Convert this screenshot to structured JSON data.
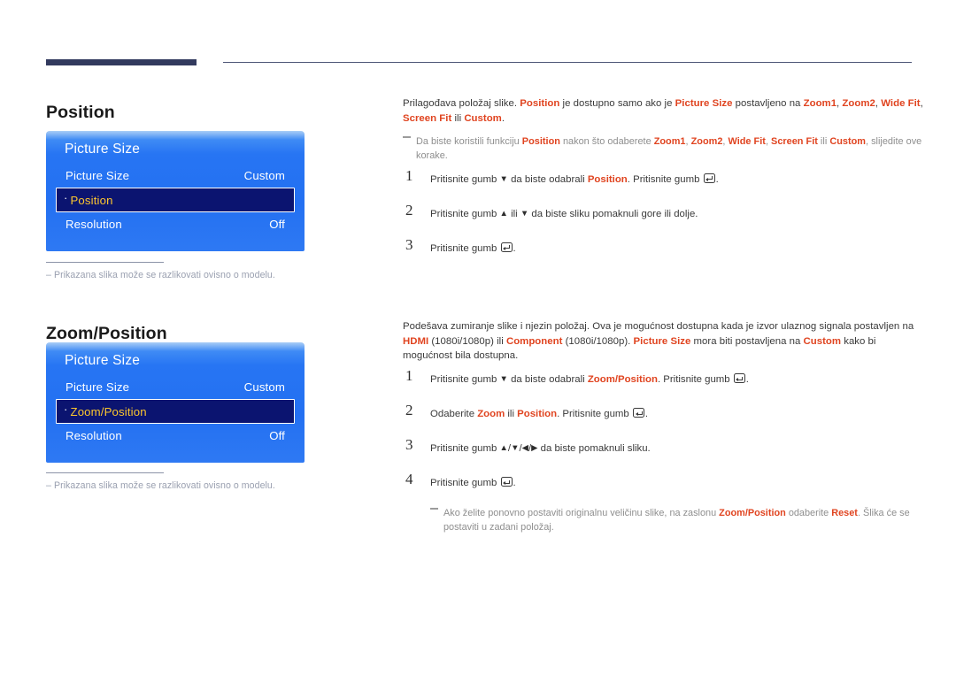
{
  "page": {
    "language": "hr",
    "accent_color": "#e04420",
    "panel_blue": "#2370f2",
    "panel_selected_bg": "#0b1470",
    "panel_selected_text": "#fdc72e",
    "rule_color": "#323a5e"
  },
  "sections": [
    {
      "id": "position",
      "title": "Position",
      "osd": {
        "header": "Picture Size",
        "rows": [
          {
            "label": "Picture Size",
            "value": "Custom",
            "selected": false,
            "bullet": ""
          },
          {
            "label": "Position",
            "value": "",
            "selected": true,
            "bullet": "·"
          },
          {
            "label": "Resolution",
            "value": "Off",
            "selected": false,
            "bullet": ""
          }
        ]
      },
      "panel_note": {
        "dash": "–",
        "text": "Prikazana slika može se razlikovati ovisno o modelu."
      },
      "intro": {
        "lead": "Prilagođava položaj slike. ",
        "hl1": "Position",
        "mid1": " je dostupno samo ako je ",
        "hl2": "Picture Size",
        "mid2": " postavljeno na ",
        "hl3": "Zoom1",
        "sep1": ", ",
        "hl4": "Zoom2",
        "sep2": ", ",
        "hl5": "Wide Fit",
        "sep3": ", ",
        "hl6": "Screen Fit",
        "mid3": " ili ",
        "hl7": "Custom",
        "tail": "."
      },
      "note": {
        "p1": "Da biste koristili funkciju ",
        "hl1": "Position",
        "p2": " nakon što odaberete ",
        "hl2": "Zoom1",
        "s1": ", ",
        "hl3": "Zoom2",
        "s2": ", ",
        "hl4": "Wide Fit",
        "s3": ", ",
        "hl5": "Screen Fit",
        "p3": " ili ",
        "hl6": "Custom",
        "p4": ", slijedite ove korake."
      },
      "steps": [
        {
          "num": "1",
          "parts": [
            {
              "t": "text",
              "v": "Pritisnite gumb "
            },
            {
              "t": "arrow",
              "v": "▼"
            },
            {
              "t": "text",
              "v": " da biste odabrali "
            },
            {
              "t": "hl",
              "v": "Position"
            },
            {
              "t": "text",
              "v": ". Pritisnite gumb "
            },
            {
              "t": "enter",
              "v": ""
            },
            {
              "t": "text",
              "v": "."
            }
          ]
        },
        {
          "num": "2",
          "parts": [
            {
              "t": "text",
              "v": "Pritisnite gumb "
            },
            {
              "t": "arrow",
              "v": "▲"
            },
            {
              "t": "text",
              "v": " ili "
            },
            {
              "t": "arrow",
              "v": "▼"
            },
            {
              "t": "text",
              "v": " da biste sliku pomaknuli gore ili dolje."
            }
          ]
        },
        {
          "num": "3",
          "parts": [
            {
              "t": "text",
              "v": "Pritisnite gumb "
            },
            {
              "t": "enter",
              "v": ""
            },
            {
              "t": "text",
              "v": "."
            }
          ]
        }
      ],
      "subnote": null
    },
    {
      "id": "zoom-position",
      "title": "Zoom/Position",
      "osd": {
        "header": "Picture Size",
        "rows": [
          {
            "label": "Picture Size",
            "value": "Custom",
            "selected": false,
            "bullet": ""
          },
          {
            "label": "Zoom/Position",
            "value": "",
            "selected": true,
            "bullet": "·"
          },
          {
            "label": "Resolution",
            "value": "Off",
            "selected": false,
            "bullet": ""
          }
        ]
      },
      "panel_note": {
        "dash": "–",
        "text": "Prikazana slika može se razlikovati ovisno o modelu."
      },
      "intro2": {
        "lead": "Podešava zumiranje slike i njezin položaj. Ova je mogućnost dostupna kada je izvor ulaznog signala postavljen na ",
        "hl1": "HDMI",
        "mid1": " (1080i/1080p) ili ",
        "hl2": "Component",
        "mid2": " (1080i/1080p). ",
        "hl3": "Picture Size",
        "mid3": " mora biti postavljena na ",
        "hl4": "Custom",
        "tail": " kako bi mogućnost bila dostupna."
      },
      "steps": [
        {
          "num": "1",
          "parts": [
            {
              "t": "text",
              "v": "Pritisnite gumb "
            },
            {
              "t": "arrow",
              "v": "▼"
            },
            {
              "t": "text",
              "v": " da biste odabrali "
            },
            {
              "t": "hl",
              "v": "Zoom/Position"
            },
            {
              "t": "text",
              "v": ". Pritisnite gumb "
            },
            {
              "t": "enter",
              "v": ""
            },
            {
              "t": "text",
              "v": "."
            }
          ]
        },
        {
          "num": "2",
          "parts": [
            {
              "t": "text",
              "v": "Odaberite "
            },
            {
              "t": "hl",
              "v": "Zoom"
            },
            {
              "t": "text",
              "v": " ili "
            },
            {
              "t": "hl",
              "v": "Position"
            },
            {
              "t": "text",
              "v": ". Pritisnite gumb "
            },
            {
              "t": "enter",
              "v": ""
            },
            {
              "t": "text",
              "v": "."
            }
          ]
        },
        {
          "num": "3",
          "parts": [
            {
              "t": "text",
              "v": "Pritisnite gumb "
            },
            {
              "t": "arrow",
              "v": "▲"
            },
            {
              "t": "text",
              "v": "/"
            },
            {
              "t": "arrow",
              "v": "▼"
            },
            {
              "t": "text",
              "v": "/"
            },
            {
              "t": "arrow",
              "v": "◀"
            },
            {
              "t": "text",
              "v": "/"
            },
            {
              "t": "arrow",
              "v": "▶"
            },
            {
              "t": "text",
              "v": " da biste pomaknuli sliku."
            }
          ]
        },
        {
          "num": "4",
          "parts": [
            {
              "t": "text",
              "v": "Pritisnite gumb "
            },
            {
              "t": "enter",
              "v": ""
            },
            {
              "t": "text",
              "v": "."
            }
          ]
        }
      ],
      "subnote": {
        "p1": "Ako želite ponovno postaviti originalnu veličinu slike, na zaslonu ",
        "hl1": "Zoom/Position",
        "p2": " odaberite ",
        "hl2": "Reset",
        "p3": ". Šlika će se postaviti u zadani položaj."
      }
    }
  ]
}
